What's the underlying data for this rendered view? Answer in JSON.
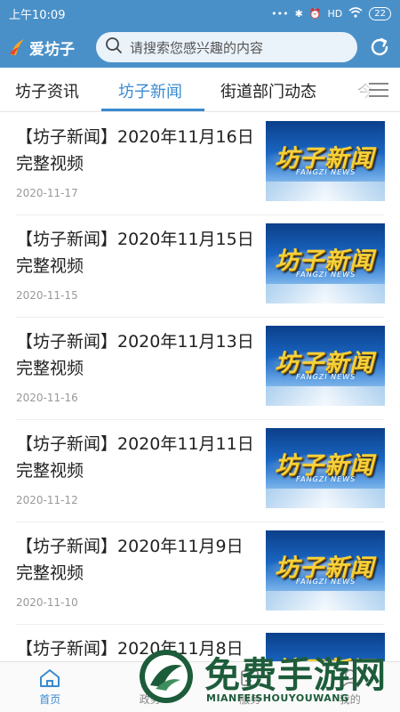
{
  "status_bar": {
    "time": "上午10:09",
    "network": "HD",
    "battery": "22"
  },
  "header": {
    "app_name": "爱坊子",
    "search_placeholder": "请搜索您感兴趣的内容"
  },
  "tabs": [
    {
      "label": "坊子资讯",
      "active": false
    },
    {
      "label": "坊子新闻",
      "active": true
    },
    {
      "label": "街道部门动态",
      "active": false
    },
    {
      "label": "今",
      "active": false
    }
  ],
  "news": [
    {
      "title": "【坊子新闻】2020年11月16日完整视频",
      "date": "2020-11-17"
    },
    {
      "title": "【坊子新闻】2020年11月15日完整视频",
      "date": "2020-11-15"
    },
    {
      "title": "【坊子新闻】2020年11月13日完整视频",
      "date": "2020-11-16"
    },
    {
      "title": "【坊子新闻】2020年11月11日完整视频",
      "date": "2020-11-12"
    },
    {
      "title": "【坊子新闻】2020年11月9日完整视频",
      "date": "2020-11-10"
    },
    {
      "title": "【坊子新闻】2020年11月8日完整视频",
      "date": ""
    }
  ],
  "thumbnail": {
    "title_cn": "坊子新闻",
    "title_en": "FANGZI NEWS"
  },
  "bottom_nav": [
    {
      "label": "首页",
      "icon": "home-icon",
      "active": true
    },
    {
      "label": "政务",
      "icon": "government-icon",
      "active": false
    },
    {
      "label": "服务",
      "icon": "service-icon",
      "active": false
    },
    {
      "label": "我的",
      "icon": "profile-icon",
      "active": false
    }
  ],
  "watermark": {
    "text_cn": "免费手游网",
    "text_en": "MIANFEISHOUYOUWANG"
  },
  "colors": {
    "brand_blue": "#4a90c8",
    "active_blue": "#3a8ad0",
    "watermark_green": "#1d5c3a"
  }
}
